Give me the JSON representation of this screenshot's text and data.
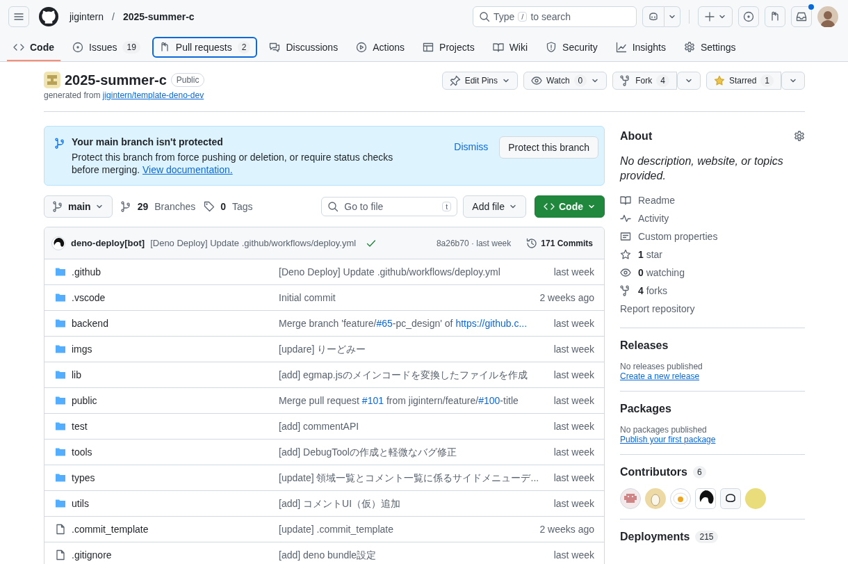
{
  "header": {
    "owner": "jigintern",
    "separator": "/",
    "repo": "2025-summer-c",
    "search": {
      "before": "Type",
      "key": "/",
      "after": "to search"
    },
    "unread_notifications": true
  },
  "tabs": [
    {
      "label": "Code",
      "selected": true,
      "focused": false
    },
    {
      "label": "Issues",
      "count": "19",
      "selected": false,
      "focused": false
    },
    {
      "label": "Pull requests",
      "count": "2",
      "selected": false,
      "focused": true
    },
    {
      "label": "Discussions",
      "selected": false,
      "focused": false
    },
    {
      "label": "Actions",
      "selected": false,
      "focused": false
    },
    {
      "label": "Projects",
      "selected": false,
      "focused": false
    },
    {
      "label": "Wiki",
      "selected": false,
      "focused": false
    },
    {
      "label": "Security",
      "selected": false,
      "focused": false
    },
    {
      "label": "Insights",
      "selected": false,
      "focused": false
    },
    {
      "label": "Settings",
      "selected": false,
      "focused": false
    }
  ],
  "repo": {
    "name": "2025-summer-c",
    "visibility": "Public",
    "generated_prefix": "generated from",
    "template": "jigintern/template-deno-dev",
    "actions": [
      {
        "label": "Edit Pins"
      },
      {
        "label": "Watch",
        "count": "0"
      },
      {
        "label": "Fork",
        "count": "4"
      },
      {
        "label": "Starred",
        "count": "1",
        "starred": true
      }
    ]
  },
  "banner": {
    "title": "Your main branch isn't protected",
    "text": "Protect this branch from force pushing or deletion, or require status checks before merging.",
    "link": "View documentation.",
    "dismiss": "Dismiss",
    "button": "Protect this branch"
  },
  "toolbar": {
    "branch": "main",
    "branches_count": "29",
    "branches_label": "Branches",
    "tags_count": "0",
    "tags_label": "Tags",
    "file_search": "Go to file",
    "file_search_key": "t",
    "add_file": "Add file",
    "code": "Code"
  },
  "commit": {
    "author": "deno-deploy[bot]",
    "message": "[Deno Deploy] Update .github/workflows/deploy.yml",
    "passed": true,
    "hash": "8a26b70 · last week",
    "commits": "171 Commits"
  },
  "files": [
    {
      "kind": "folder",
      "name": ".github",
      "message": [
        {
          "text": "[Deno Deploy] Update .github/workflows/deploy.yml",
          "link": false
        }
      ],
      "time": "last week"
    },
    {
      "kind": "folder",
      "name": ".vscode",
      "message": [
        {
          "text": "Initial commit",
          "link": false
        }
      ],
      "time": "2 weeks ago"
    },
    {
      "kind": "folder",
      "name": "backend",
      "message": [
        {
          "text": "Merge branch 'feature/",
          "link": false
        },
        {
          "text": "#65",
          "link": true
        },
        {
          "text": "-pc_design' of ",
          "link": false
        },
        {
          "text": "https://github.c...",
          "link": true
        }
      ],
      "time": "last week"
    },
    {
      "kind": "folder",
      "name": "imgs",
      "message": [
        {
          "text": "[updare] りーどみー",
          "link": false
        }
      ],
      "time": "last week"
    },
    {
      "kind": "folder",
      "name": "lib",
      "message": [
        {
          "text": "[add] egmap.jsのメインコードを変換したファイルを作成",
          "link": false
        }
      ],
      "time": "last week"
    },
    {
      "kind": "folder",
      "name": "public",
      "message": [
        {
          "text": "Merge pull request ",
          "link": false
        },
        {
          "text": "#101",
          "link": true
        },
        {
          "text": " from jigintern/feature/",
          "link": false
        },
        {
          "text": "#100",
          "link": true
        },
        {
          "text": "-title",
          "link": false
        }
      ],
      "time": "last week"
    },
    {
      "kind": "folder",
      "name": "test",
      "message": [
        {
          "text": "[add] commentAPI",
          "link": false
        }
      ],
      "time": "last week"
    },
    {
      "kind": "folder",
      "name": "tools",
      "message": [
        {
          "text": "[add] DebugToolの作成と軽微なバグ修正",
          "link": false
        }
      ],
      "time": "last week"
    },
    {
      "kind": "folder",
      "name": "types",
      "message": [
        {
          "text": "[update] 領域一覧とコメント一覧に係るサイドメニューデ...",
          "link": false
        }
      ],
      "time": "last week"
    },
    {
      "kind": "folder",
      "name": "utils",
      "message": [
        {
          "text": "[add] コメントUI（仮）追加",
          "link": false
        }
      ],
      "time": "last week"
    },
    {
      "kind": "file",
      "name": ".commit_template",
      "message": [
        {
          "text": "[update] .commit_template",
          "link": false
        }
      ],
      "time": "2 weeks ago"
    },
    {
      "kind": "file",
      "name": ".gitignore",
      "message": [
        {
          "text": "[add] deno bundle設定",
          "link": false
        }
      ],
      "time": "last week"
    }
  ],
  "about": {
    "title": "About",
    "description": "No description, website, or topics provided.",
    "items": [
      {
        "text": "Readme"
      },
      {
        "text": "Activity"
      },
      {
        "text": "Custom properties"
      },
      {
        "count": "1",
        "text": "star"
      },
      {
        "count": "0",
        "text": "watching"
      },
      {
        "count": "4",
        "text": "forks"
      }
    ],
    "report": "Report repository"
  },
  "releases": {
    "title": "Releases",
    "empty": "No releases published",
    "link": "Create a new release"
  },
  "packages": {
    "title": "Packages",
    "empty": "No packages published",
    "link": "Publish your first package"
  },
  "contributors": {
    "title": "Contributors",
    "count": "6",
    "avatars": [
      {
        "kind": "pixel"
      },
      {
        "kind": "cat"
      },
      {
        "kind": "egg"
      },
      {
        "kind": "dino"
      },
      {
        "kind": "bot"
      },
      {
        "kind": "plain"
      }
    ]
  },
  "deployments": {
    "title": "Deployments",
    "count": "215"
  }
}
